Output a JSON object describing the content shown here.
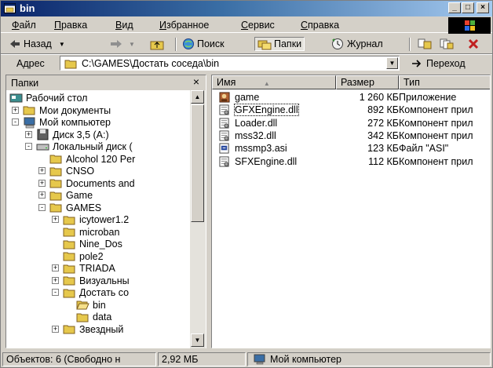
{
  "window": {
    "title": "bin",
    "controls": {
      "minimize": "_",
      "maximize": "□",
      "close": "×"
    }
  },
  "menu": [
    {
      "label": "Файл",
      "accel": "Ф",
      "rest": "айл"
    },
    {
      "label": "Правка",
      "accel": "П",
      "rest": "равка"
    },
    {
      "label": "Вид",
      "accel": "В",
      "rest": "ид"
    },
    {
      "label": "Избранное",
      "accel": "И",
      "rest": "збранное"
    },
    {
      "label": "Сервис",
      "accel": "С",
      "rest": "ервис"
    },
    {
      "label": "Справка",
      "accel": "С",
      "rest": "правка"
    }
  ],
  "toolbar": {
    "back": "Назад",
    "search": "Поиск",
    "folders": "Папки",
    "history": "Журнал"
  },
  "address": {
    "label": "Адрес",
    "path": "C:\\GAMES\\Достать соседа\\bin",
    "go": "Переход"
  },
  "left_pane": {
    "title": "Папки",
    "close": "×",
    "tree": [
      {
        "label": "Рабочий стол",
        "icon": "desktop-icon",
        "level": 0,
        "expander": ""
      },
      {
        "label": "Мои документы",
        "icon": "folder-icon",
        "level": 1,
        "expander": "+"
      },
      {
        "label": "Мой компьютер",
        "icon": "computer-icon",
        "level": 1,
        "expander": "-"
      },
      {
        "label": "Диск 3,5 (A:)",
        "icon": "floppy-icon",
        "level": 2,
        "expander": "+"
      },
      {
        "label": "Локальный диск (",
        "icon": "drive-icon",
        "level": 2,
        "expander": "-"
      },
      {
        "label": "Alcohol 120 Per",
        "icon": "folder-icon",
        "level": 3,
        "expander": ""
      },
      {
        "label": "CNSO",
        "icon": "folder-icon",
        "level": 3,
        "expander": "+"
      },
      {
        "label": "Documents and",
        "icon": "folder-icon",
        "level": 3,
        "expander": "+"
      },
      {
        "label": "Game",
        "icon": "folder-icon",
        "level": 3,
        "expander": "+"
      },
      {
        "label": "GAMES",
        "icon": "folder-icon",
        "level": 3,
        "expander": "-"
      },
      {
        "label": "icytower1.2",
        "icon": "folder-icon",
        "level": 4,
        "expander": "+"
      },
      {
        "label": "microban",
        "icon": "folder-icon",
        "level": 4,
        "expander": ""
      },
      {
        "label": "Nine_Dos",
        "icon": "folder-icon",
        "level": 4,
        "expander": ""
      },
      {
        "label": "pole2",
        "icon": "folder-icon",
        "level": 4,
        "expander": ""
      },
      {
        "label": "TRIADA",
        "icon": "folder-icon",
        "level": 4,
        "expander": "+"
      },
      {
        "label": "Визуальны",
        "icon": "folder-icon",
        "level": 4,
        "expander": "+"
      },
      {
        "label": "Достать со",
        "icon": "folder-icon",
        "level": 4,
        "expander": "-"
      },
      {
        "label": "bin",
        "icon": "folder-open-icon",
        "level": 5,
        "expander": ""
      },
      {
        "label": "data",
        "icon": "folder-icon",
        "level": 5,
        "expander": ""
      },
      {
        "label": "Звездный",
        "icon": "folder-icon",
        "level": 4,
        "expander": "+"
      }
    ]
  },
  "right_pane": {
    "columns": {
      "name": "Имя",
      "size": "Размер",
      "type": "Тип"
    },
    "sort_arrow": "▲",
    "files": [
      {
        "name": "game",
        "size": "1 260 КБ",
        "type": "Приложение",
        "icon": "app-icon"
      },
      {
        "name": "GFXEngine.dll",
        "size": "892 КБ",
        "type": "Компонент прил",
        "icon": "dll-icon"
      },
      {
        "name": "Loader.dll",
        "size": "272 КБ",
        "type": "Компонент прил",
        "icon": "dll-icon"
      },
      {
        "name": "mss32.dll",
        "size": "342 КБ",
        "type": "Компонент прил",
        "icon": "dll-icon"
      },
      {
        "name": "mssmp3.asi",
        "size": "123 КБ",
        "type": "Файл \"ASI\"",
        "icon": "asi-icon"
      },
      {
        "name": "SFXEngine.dll",
        "size": "112 КБ",
        "type": "Компонент прил",
        "icon": "dll-icon"
      }
    ]
  },
  "status": {
    "objects": "Объектов: 6 (Свободно н",
    "size": "2,92 МБ",
    "location": "Мой компьютер"
  }
}
